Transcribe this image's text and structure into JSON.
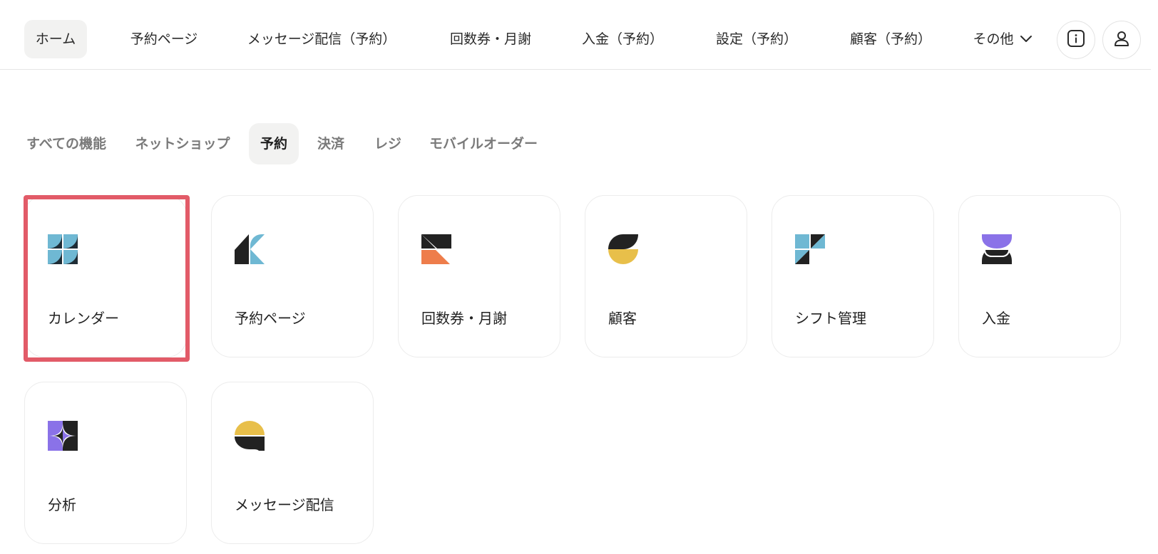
{
  "nav": {
    "items": [
      {
        "label": "ホーム"
      },
      {
        "label": "予約ページ"
      },
      {
        "label": "メッセージ配信（予約）"
      },
      {
        "label": "回数券・月謝"
      },
      {
        "label": "入金（予約）"
      },
      {
        "label": "設定（予約）"
      },
      {
        "label": "顧客（予約）"
      }
    ],
    "more_label": "その他",
    "active_index": 0
  },
  "tabs": {
    "items": [
      {
        "label": "すべての機能"
      },
      {
        "label": "ネットショップ"
      },
      {
        "label": "予約"
      },
      {
        "label": "決済"
      },
      {
        "label": "レジ"
      },
      {
        "label": "モバイルオーダー"
      }
    ],
    "active_index": 2
  },
  "cards": [
    {
      "label": "カレンダー",
      "icon": "calendar-icon",
      "highlighted": true
    },
    {
      "label": "予約ページ",
      "icon": "reservation-page-icon"
    },
    {
      "label": "回数券・月謝",
      "icon": "ticket-icon"
    },
    {
      "label": "顧客",
      "icon": "customer-icon"
    },
    {
      "label": "シフト管理",
      "icon": "shift-icon"
    },
    {
      "label": "入金",
      "icon": "deposit-icon"
    },
    {
      "label": "分析",
      "icon": "analytics-icon"
    },
    {
      "label": "メッセージ配信",
      "icon": "message-icon"
    }
  ],
  "colors": {
    "highlight": "#e25b68",
    "blue": "#6fb8d3",
    "dark": "#222222",
    "orange": "#ee7d4b",
    "yellow": "#e8bf4a",
    "purple": "#8a72e8"
  }
}
